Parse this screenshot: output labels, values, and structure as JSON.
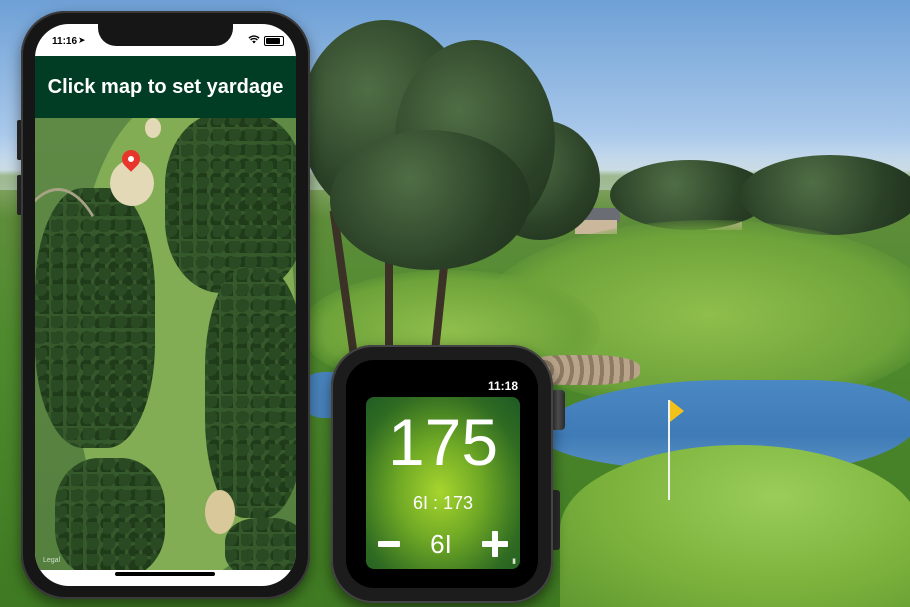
{
  "phone": {
    "status_time": "11:16",
    "banner_text": "Click map to set yardage",
    "map_legal": "Legal"
  },
  "watch": {
    "time": "11:18",
    "distance": "175",
    "club_detail": "6I : 173",
    "club": "6I"
  },
  "colors": {
    "banner_bg": "#003d24",
    "pin": "#e8352b",
    "watch_panel": "#6ea825"
  },
  "icons": [
    "location-arrow-icon",
    "wifi-icon",
    "battery-icon",
    "map-pin-icon",
    "minus-icon",
    "plus-icon",
    "golf-flag-icon"
  ]
}
